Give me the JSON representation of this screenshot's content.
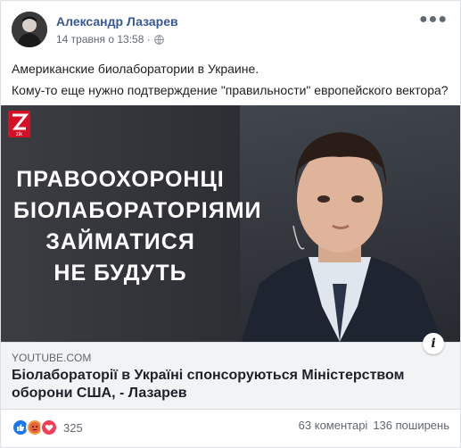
{
  "post": {
    "author": "Александр Лазарев",
    "timestamp": "14 травня о 13:58 ·",
    "text_lines": [
      "Американские биолаборатории в Украине.",
      "Кому-то еще нужно подтверждение \"правильности\" европейского вектора?"
    ]
  },
  "link_card": {
    "image_text_lines": [
      "ПРАВООХОРОНЦІ",
      "БІОЛАБОРАТОРІЯМИ",
      "ЗАЙМАТИСЯ",
      "НЕ БУДУТЬ"
    ],
    "channel_logo_text": "zik",
    "domain": "YOUTUBE.COM",
    "title": "Біолабораторії в Україні спонсоруються Міністерством оборони США, - Лазарев"
  },
  "footer": {
    "reaction_count": "325",
    "comments": "63 коментарі",
    "shares": "136 поширень"
  },
  "icons": {
    "more": "more-options-icon",
    "privacy": "globe-icon",
    "info": "info-icon",
    "reactions": [
      "like-icon",
      "angry-icon",
      "love-icon"
    ]
  },
  "colors": {
    "author_link": "#385898",
    "like": "#1877f2",
    "angry": "#f2994a",
    "love": "#f33e58",
    "zik_red": "#d60f25"
  }
}
